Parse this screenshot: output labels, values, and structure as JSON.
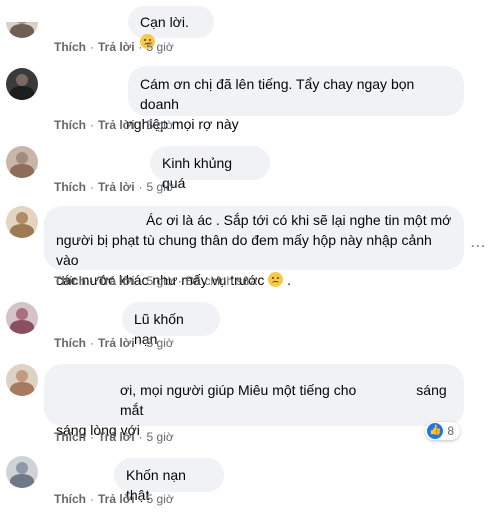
{
  "comments": [
    {
      "text": "Cạn lời.",
      "emoji": "😥",
      "like": "Thích",
      "reply": "Trả lời",
      "time": "5 giờ"
    },
    {
      "line1": "Cám ơn chị đã lên tiếng. Tẩy chay ngay bọn doanh",
      "line2": "nghiệp mọi rợ này",
      "like": "Thích",
      "reply": "Trả lời",
      "time": "5 giờ"
    },
    {
      "text": "Kinh khủng quá",
      "like": "Thích",
      "reply": "Trả lời",
      "time": "5 giờ"
    },
    {
      "line1": "Ác ơi là ác . Sắp tới có khi sẽ lại nghe tin một mớ",
      "line2": "người bị phạt tù chung thân do đem mấy hộp này nhập cảnh vào",
      "line3": "các nước khác như mấy vụ trước",
      "emoji": "😥",
      "line3_end": ".",
      "like": "Thích",
      "reply": "Trả lời",
      "time": "5 giờ",
      "edited": "Đã chỉnh sửa"
    },
    {
      "text": "Lũ khốn nạn",
      "like": "Thích",
      "reply": "Trả lời",
      "time": "5 giờ"
    },
    {
      "line1a": "ơi, mọi người giúp Miêu một tiếng cho",
      "line1b": "sáng mắt",
      "line2": "sáng lòng với",
      "like": "Thích",
      "reply": "Trả lời",
      "time": "5 giờ",
      "reaction_count": "8"
    },
    {
      "text": "Khốn nạn thật",
      "like": "Thích",
      "reply": "Trả lời",
      "time": "5 giờ"
    }
  ],
  "separator": "·",
  "icons": {
    "like_reaction": "thumbs-up-icon",
    "more": "more-options-icon"
  }
}
